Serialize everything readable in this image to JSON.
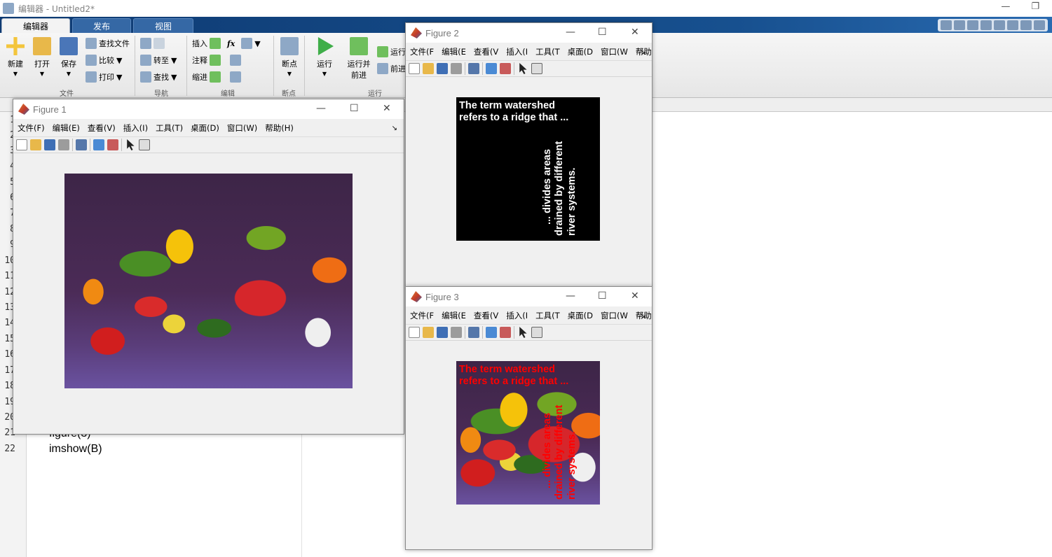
{
  "main_window": {
    "title": "编辑器 - Untitled2*",
    "tabs": [
      "编辑器",
      "发布",
      "视图"
    ]
  },
  "ribbon": {
    "file": {
      "new": "新建",
      "open": "打开",
      "save": "保存",
      "find_files": "查找文件",
      "compare": "比较",
      "print": "打印",
      "group": "文件"
    },
    "nav": {
      "goto": "转至",
      "find": "查找",
      "group": "导航"
    },
    "edit": {
      "insert": "插入",
      "comment": "注释",
      "indent": "缩进",
      "fx": "fx",
      "group": "编辑"
    },
    "breakpoints": {
      "label": "断点",
      "group": "断点"
    },
    "run": {
      "run": "运行",
      "run_advance": "运行并\n前进",
      "run_section": "运行",
      "advance": "前进",
      "group": "运行"
    }
  },
  "editor": {
    "line_numbers": [
      "1",
      "2",
      "3",
      "4",
      "5",
      "6",
      "7",
      "8",
      "9",
      "10",
      "11",
      "12",
      "13",
      "14",
      "15",
      "16",
      "17",
      "18",
      "19",
      "20",
      "21",
      "22"
    ],
    "code_lines": {
      "line21": "figure(3)",
      "line22": "imshow(B)"
    }
  },
  "figure1": {
    "title": "Figure 1",
    "menu": [
      "文件(F)",
      "编辑(E)",
      "查看(V)",
      "插入(I)",
      "工具(T)",
      "桌面(D)",
      "窗口(W)",
      "帮助(H)"
    ]
  },
  "figure2": {
    "title": "Figure 2",
    "menu": [
      "文件(F",
      "编辑(E",
      "查看(V",
      "插入(I",
      "工具(T",
      "桌面(D",
      "窗口(W",
      "帮助(H"
    ],
    "text_line1": "The term watershed",
    "text_line2": "refers to a ridge that ...",
    "vtext_line1": "... divides areas",
    "vtext_line2": "drained by different",
    "vtext_line3": "river systems."
  },
  "figure3": {
    "title": "Figure 3",
    "menu": [
      "文件(F",
      "编辑(E",
      "查看(V",
      "插入(I",
      "工具(T",
      "桌面(D",
      "窗口(W",
      "帮助(H"
    ],
    "text_line1": "The term watershed",
    "text_line2": "refers to a ridge that ...",
    "vtext_line1": "... divides areas",
    "vtext_line2": "drained by different",
    "vtext_line3": "river systems."
  },
  "colors": {
    "ribbon_tab_bar": "#17508f",
    "overlay_white": "#ffffff",
    "overlay_red": "#ff0000"
  }
}
